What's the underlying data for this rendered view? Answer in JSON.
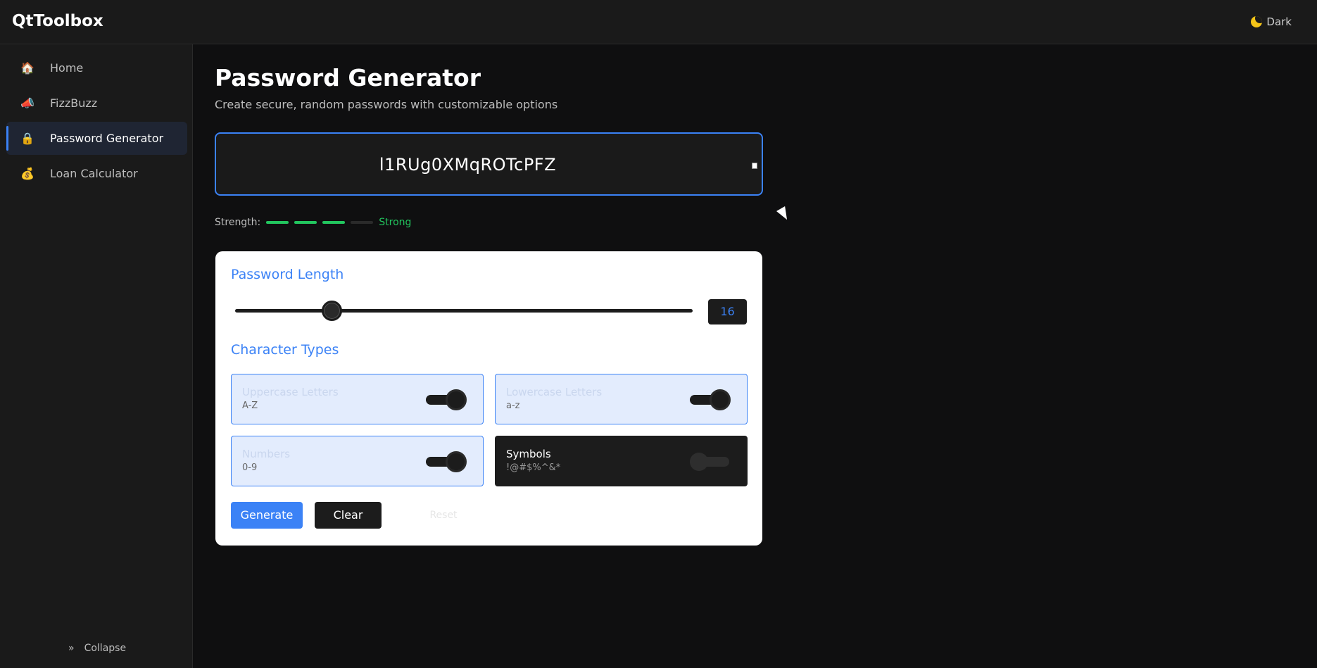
{
  "app": {
    "title": "QtToolbox",
    "theme_label": "Dark"
  },
  "sidebar": {
    "items": [
      {
        "label": "Home",
        "icon": "house-icon",
        "glyph": "🏠"
      },
      {
        "label": "FizzBuzz",
        "icon": "megaphone-icon",
        "glyph": "📣"
      },
      {
        "label": "Password Generator",
        "icon": "lock-icon",
        "glyph": "🔒",
        "active": true
      },
      {
        "label": "Loan Calculator",
        "icon": "money-bag-icon",
        "glyph": "💰"
      }
    ],
    "collapse_label": "Collapse",
    "collapse_glyph": "»"
  },
  "page": {
    "title": "Password Generator",
    "subtitle": "Create secure, random passwords with customizable options"
  },
  "password": {
    "value": "l1RUg0XMqROTcPFZ"
  },
  "strength": {
    "label_prefix": "Strength:",
    "level": 3,
    "max": 4,
    "label": "Strong",
    "color": "#22c55e"
  },
  "length": {
    "section_title": "Password Length",
    "value": "16",
    "fraction": 0.21
  },
  "char_types": {
    "section_title": "Character Types",
    "options": [
      {
        "title": "Uppercase Letters",
        "sub": "A-Z",
        "enabled": true
      },
      {
        "title": "Lowercase Letters",
        "sub": "a-z",
        "enabled": true
      },
      {
        "title": "Numbers",
        "sub": "0-9",
        "enabled": true
      },
      {
        "title": "Symbols",
        "sub": "!@#$%^&*",
        "enabled": false
      }
    ]
  },
  "actions": {
    "generate": "Generate",
    "clear": "Clear",
    "reset": "Reset"
  },
  "colors": {
    "accent": "#3b82f6",
    "strength": "#22c55e",
    "background": "#0f0f10"
  }
}
